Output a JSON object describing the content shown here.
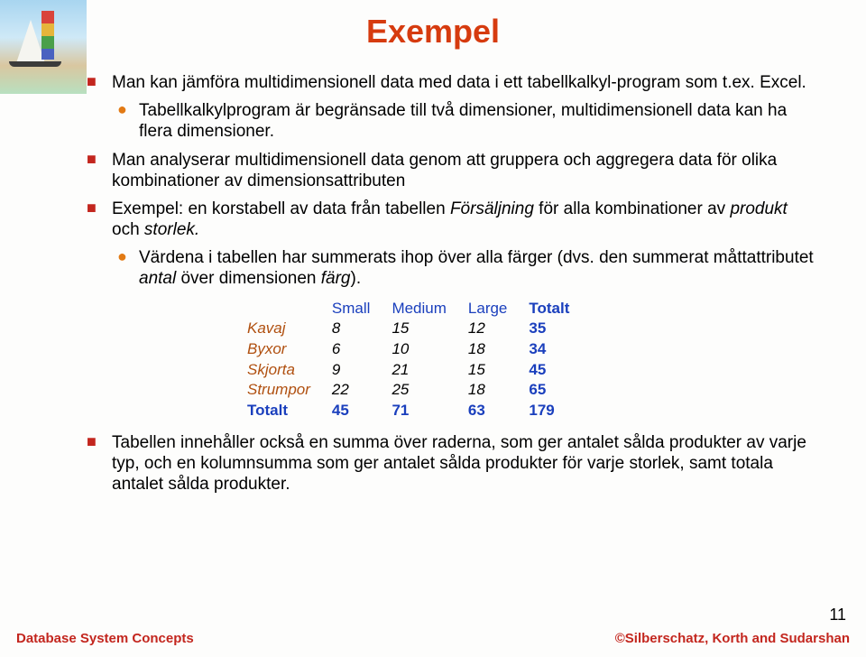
{
  "title": "Exempel",
  "bullets": {
    "b1": "Man kan jämföra multidimensionell data med data i ett tabellkalkyl-program som t.ex. Excel.",
    "b1a": "Tabellkalkylprogram är begränsade till två dimensioner, multidimensionell data kan ha flera dimensioner.",
    "b2": "Man analyserar multidimensionell data genom att gruppera och aggregera data för olika kombinationer av dimensionsattributen",
    "b3_pre": "Exempel: en korstabell av data från tabellen ",
    "b3_em1": "Försäljning",
    "b3_mid": " för alla kombinationer av ",
    "b3_em2": "produkt",
    "b3_mid2": " och ",
    "b3_em3": "storlek.",
    "b3a_pre": "Värdena i tabellen har summerats ihop över alla färger (dvs. den summerat måttattributet ",
    "b3a_em1": "antal",
    "b3a_mid": " över dimensionen ",
    "b3a_em2": "färg",
    "b3a_post": ").",
    "b4": "Tabellen innehåller också en summa över raderna, som ger antalet sålda produkter av varje typ, och en kolumnsumma som ger antalet sålda produkter för varje storlek, samt totala antalet sålda produkter."
  },
  "chart_data": {
    "type": "table",
    "columns": [
      "Small",
      "Medium",
      "Large",
      "Totalt"
    ],
    "rows": [
      {
        "label": "Kavaj",
        "values": [
          8,
          15,
          12,
          35
        ]
      },
      {
        "label": "Byxor",
        "values": [
          6,
          10,
          18,
          34
        ]
      },
      {
        "label": "Skjorta",
        "values": [
          9,
          21,
          15,
          45
        ]
      },
      {
        "label": "Strumpor",
        "values": [
          22,
          25,
          18,
          65
        ]
      },
      {
        "label": "Totalt",
        "values": [
          45,
          71,
          63,
          179
        ]
      }
    ]
  },
  "footer": {
    "left": "Database System Concepts",
    "right": "©Silberschatz, Korth and Sudarshan",
    "page": "11"
  }
}
